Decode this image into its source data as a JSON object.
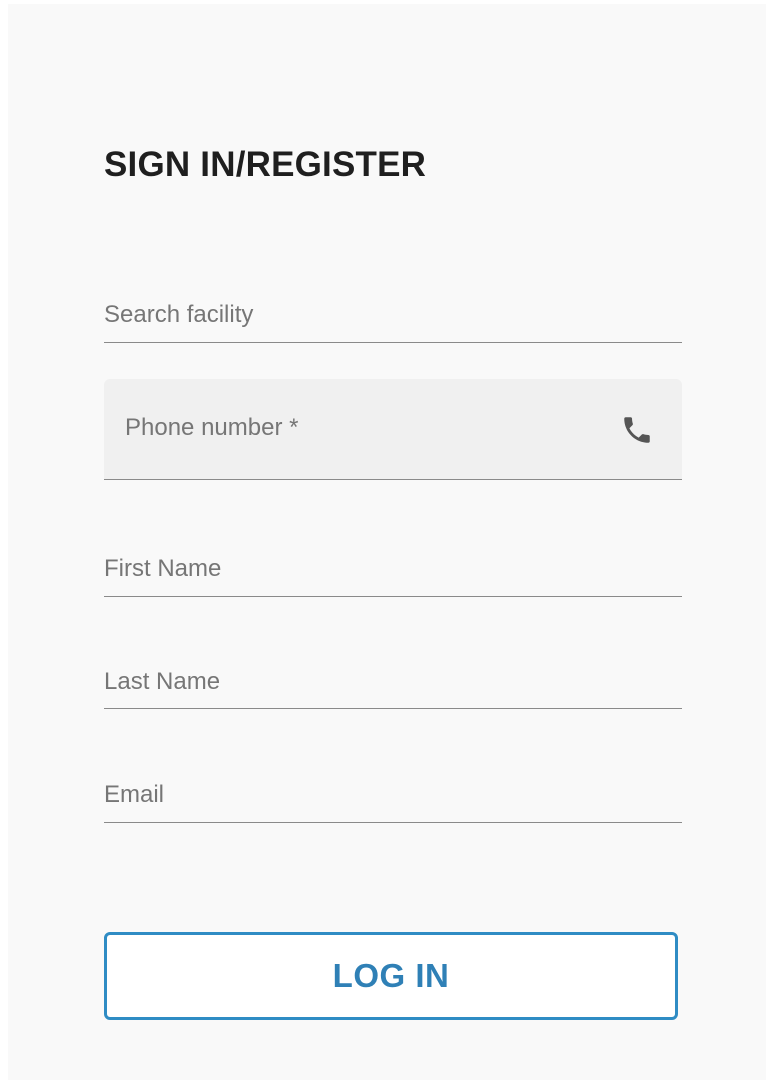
{
  "form": {
    "title": "SIGN IN/REGISTER",
    "fields": {
      "facility": {
        "label": "Search facility",
        "value": ""
      },
      "phone": {
        "label": "Phone number *",
        "value": "",
        "icon": "phone-icon"
      },
      "first_name": {
        "label": "First Name",
        "value": ""
      },
      "last_name": {
        "label": "Last Name",
        "value": ""
      },
      "email": {
        "label": "Email",
        "value": ""
      }
    },
    "login_label": "LOG IN"
  },
  "colors": {
    "panel_background": "#f9f9f9",
    "filled_field_background": "#f0f0f0",
    "accent": "#2f8cc4",
    "label_text": "#767676",
    "title_text": "#1f1f1f"
  }
}
